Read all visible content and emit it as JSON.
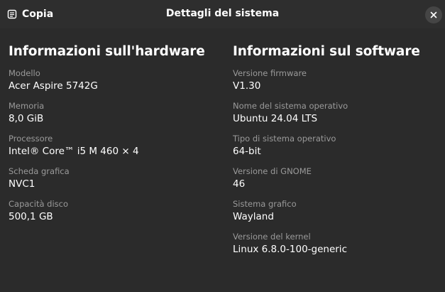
{
  "header": {
    "copy_label": "Copia",
    "title": "Dettagli del sistema",
    "copy_icon": "copy-document-icon",
    "close_icon": "close-icon"
  },
  "hardware": {
    "heading": "Informazioni sull'hardware",
    "fields": [
      {
        "label": "Modello",
        "value": "Acer Aspire 5742G"
      },
      {
        "label": "Memoria",
        "value": "8,0 GiB"
      },
      {
        "label": "Processore",
        "value": "Intel® Core™ i5 M 460  × 4"
      },
      {
        "label": "Scheda grafica",
        "value": "NVC1"
      },
      {
        "label": "Capacità disco",
        "value": "500,1 GB"
      }
    ]
  },
  "software": {
    "heading": "Informazioni sul software",
    "fields": [
      {
        "label": "Versione firmware",
        "value": "V1.30"
      },
      {
        "label": "Nome del sistema operativo",
        "value": "Ubuntu 24.04 LTS"
      },
      {
        "label": "Tipo di sistema operativo",
        "value": "64-bit"
      },
      {
        "label": "Versione di GNOME",
        "value": "46"
      },
      {
        "label": "Sistema grafico",
        "value": "Wayland"
      },
      {
        "label": "Versione del kernel",
        "value": "Linux 6.8.0-100-generic"
      }
    ]
  },
  "colors": {
    "background": "#2b2b2b",
    "label": "#9a9a9a",
    "text": "#ffffff",
    "close_button_bg": "#454545"
  }
}
